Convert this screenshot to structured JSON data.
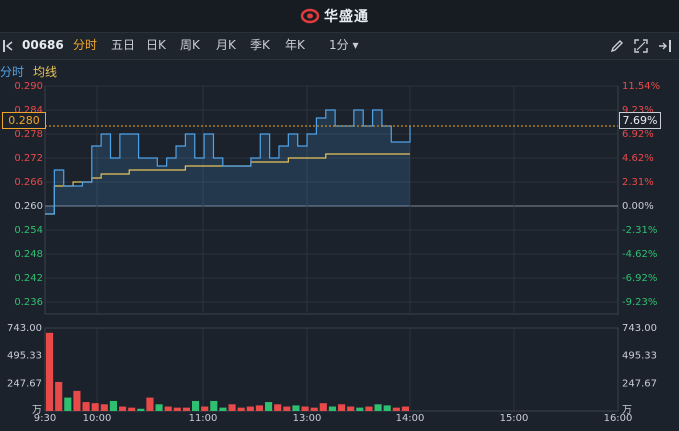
{
  "app": {
    "title": "华盛通"
  },
  "toolbar": {
    "code": "00686",
    "tabs": [
      {
        "label": "分时",
        "active": true
      },
      {
        "label": "五日",
        "active": false
      },
      {
        "label": "日K",
        "active": false
      },
      {
        "label": "周K",
        "active": false
      },
      {
        "label": "月K",
        "active": false
      },
      {
        "label": "季K",
        "active": false
      },
      {
        "label": "年K",
        "active": false
      },
      {
        "label": "1分 ▾",
        "active": false
      }
    ],
    "icons": [
      "pencil-icon",
      "fullscreen-icon",
      "exit-icon"
    ]
  },
  "legend": {
    "line1": "分时",
    "line2": "均线"
  },
  "price_axis": {
    "left_labels": [
      "0.290",
      "0.284",
      "0.278",
      "0.272",
      "0.266",
      "0.260",
      "0.254",
      "0.248",
      "0.242",
      "0.236"
    ],
    "right_labels": [
      "11.54%",
      "9.23%",
      "6.92%",
      "4.62%",
      "2.31%",
      "0.00%",
      "-2.31%",
      "-4.62%",
      "-6.92%",
      "-9.23%"
    ],
    "current_price": "0.280",
    "current_pct": "7.69%"
  },
  "volume_axis": {
    "left_labels": [
      "743.00",
      "495.33",
      "247.67",
      "万"
    ],
    "right_labels": [
      "743.00",
      "495.33",
      "247.67",
      "万"
    ]
  },
  "time_axis": [
    "9:30",
    "10:00",
    "11:00",
    "13:00",
    "14:00",
    "15:00",
    "16:00"
  ],
  "colors": {
    "up": "#e84a4a",
    "down": "#2fbf71",
    "price_line": "#4fa3e8",
    "avg_line": "#e6c35a",
    "accent": "#f3a52b"
  },
  "chart_data": {
    "type": "line",
    "series": [
      {
        "name": "分时",
        "values": [
          0.258,
          0.269,
          0.265,
          0.265,
          0.266,
          0.275,
          0.278,
          0.272,
          0.278,
          0.278,
          0.272,
          0.272,
          0.27,
          0.272,
          0.275,
          0.278,
          0.272,
          0.278,
          0.272,
          0.27,
          0.27,
          0.27,
          0.272,
          0.278,
          0.272,
          0.275,
          0.278,
          0.275,
          0.278,
          0.282,
          0.284,
          0.28,
          0.28,
          0.284,
          0.28,
          0.284,
          0.28,
          0.276,
          0.276,
          0.28
        ]
      },
      {
        "name": "均线",
        "values": [
          0.258,
          0.265,
          0.265,
          0.266,
          0.266,
          0.267,
          0.268,
          0.268,
          0.268,
          0.269,
          0.269,
          0.269,
          0.269,
          0.269,
          0.269,
          0.27,
          0.27,
          0.27,
          0.27,
          0.27,
          0.27,
          0.27,
          0.271,
          0.271,
          0.271,
          0.271,
          0.272,
          0.272,
          0.272,
          0.272,
          0.273,
          0.273,
          0.273,
          0.273,
          0.273,
          0.273,
          0.273,
          0.273,
          0.273,
          0.273
        ]
      }
    ],
    "volume": [
      700,
      260,
      120,
      180,
      80,
      70,
      60,
      90,
      40,
      30,
      20,
      120,
      60,
      40,
      30,
      30,
      90,
      40,
      90,
      30,
      60,
      30,
      40,
      50,
      80,
      60,
      40,
      50,
      40,
      30,
      70,
      40,
      60,
      40,
      30,
      40,
      60,
      50,
      30,
      40
    ],
    "ylim": [
      0.233,
      0.29
    ],
    "vol_max": 743.0
  }
}
